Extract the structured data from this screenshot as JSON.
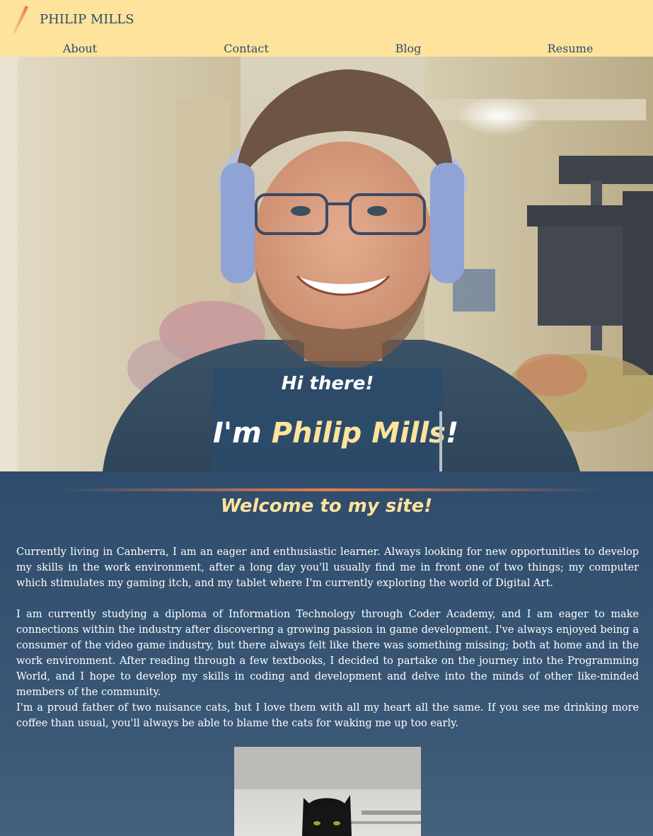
{
  "header": {
    "site_name": "PHILIP MILLS",
    "logo_icon": "pen-stroke-icon",
    "nav": [
      "About",
      "Contact",
      "Blog",
      "Resume"
    ]
  },
  "hero": {
    "greeting": "Hi there!",
    "intro_prefix": "I'm ",
    "intro_name": "Philip Mills",
    "intro_suffix": "!"
  },
  "main": {
    "welcome_heading": "Welcome to my site!",
    "paragraphs": [
      "Currently living in Canberra, I am an eager and enthusiastic learner. Always looking for new opportunities to develop my skills in the work environment, after a long day you'll usually find me in front one of two things; my computer which stimulates my gaming itch, and my tablet where I'm currently exploring the world of Digital Art.",
      "I am currently studying a diploma of Information Technology through Coder Academy, and I am eager to make connections within the industry after discovering a growing passion in game development. I've always enjoyed being a consumer of the video game industry, but there always felt like there was something missing; both at home and in the work environment. After reading through a few textbooks, I decided to partake on the journey into the Programming World, and I hope to develop my skills in coding and development and delve into the minds of other like-minded members of the community.",
      "I'm a proud father of two nuisance cats, but I love them with all my heart all the same. If you see me drinking more coffee than usual, you'll always be able to blame the cats for waking me up too early."
    ]
  },
  "colors": {
    "header_bg": "#fee39c",
    "primary_blue": "#2c4b6b",
    "accent_orange": "#e87e4b",
    "accent_yellow": "#fee39c"
  }
}
